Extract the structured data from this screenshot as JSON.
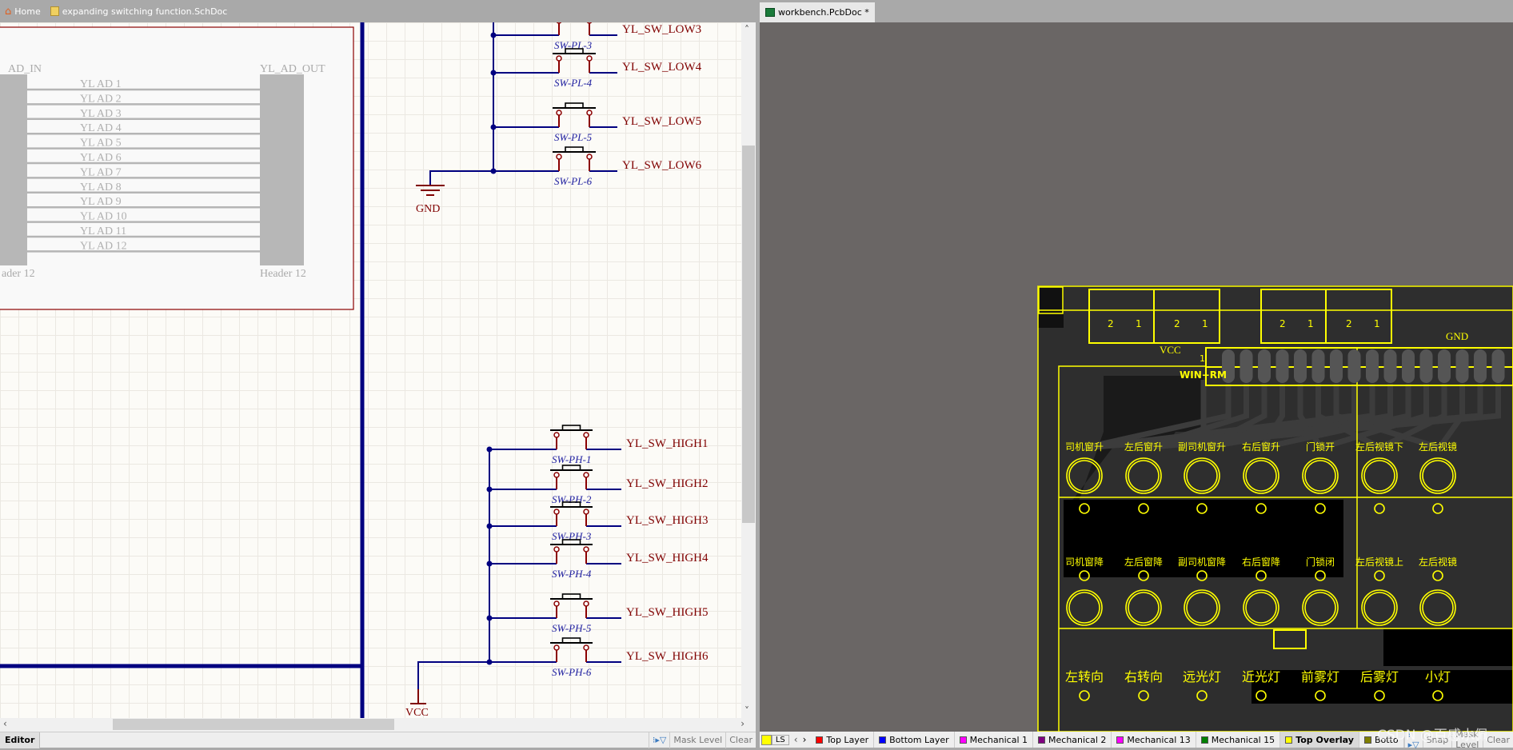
{
  "tabs": {
    "home": "Home",
    "schdoc": "expanding switching function.SchDoc",
    "pcbdoc": "workbench.PcbDoc *"
  },
  "schematic": {
    "header_left_label": "AD_IN",
    "header_right_label": "YL_AD_OUT",
    "header_left_comment": "ader 12",
    "header_right_comment": "Header 12",
    "ad_nets": [
      "YL AD 1",
      "YL AD 2",
      "YL AD 3",
      "YL AD 4",
      "YL AD 5",
      "YL AD 6",
      "YL AD 7",
      "YL AD 8",
      "YL AD 9",
      "YL AD 10",
      "YL AD 11",
      "YL AD 12"
    ],
    "low_switches": [
      {
        "designator": "SW-PL-3",
        "net": "YL_SW_LOW3"
      },
      {
        "designator": "SW-PL-4",
        "net": "YL_SW_LOW4"
      },
      {
        "designator": "SW-PL-5",
        "net": "YL_SW_LOW5"
      },
      {
        "designator": "SW-PL-6",
        "net": "YL_SW_LOW6"
      }
    ],
    "gnd": "GND",
    "high_switches": [
      {
        "designator": "SW-PH-1",
        "net": "YL_SW_HIGH1"
      },
      {
        "designator": "SW-PH-2",
        "net": "YL_SW_HIGH2"
      },
      {
        "designator": "SW-PH-3",
        "net": "YL_SW_HIGH3"
      },
      {
        "designator": "SW-PH-4",
        "net": "YL_SW_HIGH4"
      },
      {
        "designator": "SW-PH-5",
        "net": "YL_SW_HIGH5"
      },
      {
        "designator": "SW-PH-6",
        "net": "YL_SW_HIGH6"
      }
    ],
    "vcc": "VCC",
    "colors": {
      "wire": "#000080",
      "net_label": "#800000",
      "designator": "#2020a0"
    }
  },
  "left_status": {
    "editor_tab": "Editor",
    "mask_level": "Mask Level",
    "clear": "Clear"
  },
  "pcb": {
    "vcc": "VCC",
    "gnd": "GND",
    "header_label": "WIN+RM",
    "header_pin1": "1",
    "connector_pins": [
      "2",
      "1",
      "2",
      "1",
      "2",
      "1",
      "2",
      "1"
    ],
    "row1": [
      "司机窗升",
      "左后窗升",
      "副司机窗升",
      "右后窗升",
      "门锁开",
      "左后视镜下",
      "左后视镜"
    ],
    "row2": [
      "司机窗降",
      "左后窗降",
      "副司机窗降",
      "右后窗降",
      "门锁闭",
      "左后视镜上",
      "左后视镜"
    ],
    "row3": [
      "左转向",
      "右转向",
      "远光灯",
      "近光灯",
      "前雾灯",
      "后雾灯",
      "小灯"
    ],
    "silk_color": "#ffff00"
  },
  "pcb_status": {
    "current_layer_color": "#ffff00",
    "ls": "LS",
    "layers": [
      {
        "name": "Top Layer",
        "color": "#ff0000"
      },
      {
        "name": "Bottom Layer",
        "color": "#0000ff"
      },
      {
        "name": "Mechanical 1",
        "color": "#ff00ff"
      },
      {
        "name": "Mechanical 2",
        "color": "#800080"
      },
      {
        "name": "Mechanical 13",
        "color": "#ff00ff"
      },
      {
        "name": "Mechanical 15",
        "color": "#008000"
      },
      {
        "name": "Top Overlay",
        "color": "#ffff00",
        "active": true
      },
      {
        "name": "Botto",
        "color": "#808000"
      }
    ],
    "snap": "Snap",
    "mask_level": "Mask Level",
    "clear": "Clear"
  },
  "watermark": "CSDN @百感水佩"
}
